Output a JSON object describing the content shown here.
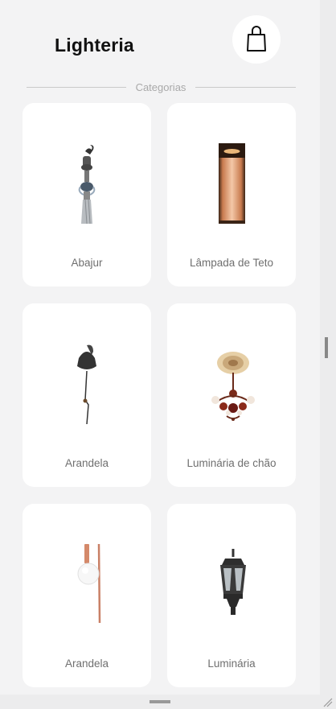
{
  "header": {
    "title": "Lighteria",
    "cart_icon": "shopping-bag-icon"
  },
  "section": {
    "label": "Categorias"
  },
  "categories": [
    {
      "label": "Abajur",
      "icon": "street-lamp-image"
    },
    {
      "label": "Lâmpada de Teto",
      "icon": "copper-tube-light-image"
    },
    {
      "label": "Arandela",
      "icon": "black-pendant-lamp-image"
    },
    {
      "label": "Luminária de chão",
      "icon": "chandelier-image"
    },
    {
      "label": "Arandela",
      "icon": "copper-wall-lamp-image"
    },
    {
      "label": "Luminária",
      "icon": "lantern-image"
    }
  ],
  "colors": {
    "background": "#f3f3f4",
    "card": "#ffffff",
    "text_primary": "#111111",
    "text_secondary": "#6f6f6f",
    "divider_text": "#a9a9a9"
  }
}
